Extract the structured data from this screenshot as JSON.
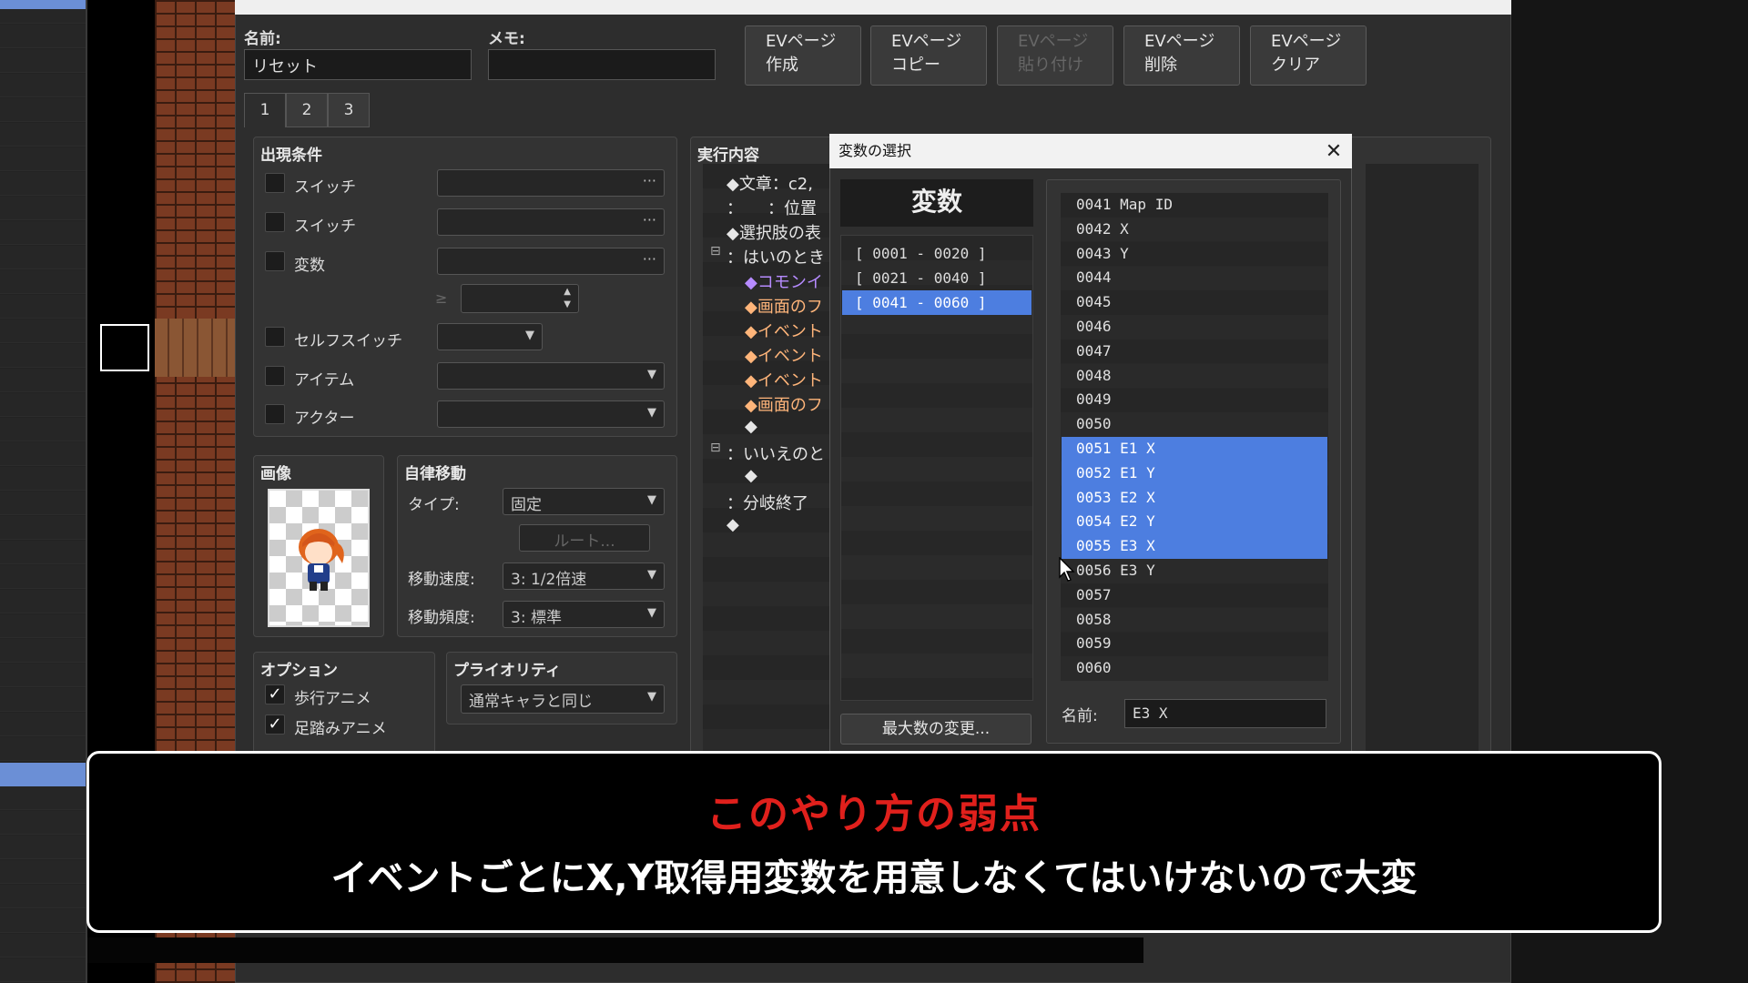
{
  "event_editor": {
    "name_label": "名前:",
    "name_value": "リセット",
    "memo_label": "メモ:",
    "memo_value": "",
    "buttons": [
      "EVページ\n作成",
      "EVページ\nコピー",
      "EVページ\n貼り付け",
      "EVページ\n削除",
      "EVページ\nクリア"
    ],
    "tabs": [
      "1",
      "2",
      "3"
    ],
    "conditions": {
      "title": "出現条件",
      "rows": [
        "スイッチ",
        "スイッチ",
        "変数",
        "セルフスイッチ",
        "アイテム",
        "アクター"
      ],
      "ge_symbol": "≥"
    },
    "image": {
      "title": "画像"
    },
    "autonomous": {
      "title": "自律移動",
      "type_label": "タイプ:",
      "type_value": "固定",
      "route_button": "ルート...",
      "speed_label": "移動速度:",
      "speed_value": "3: 1/2倍速",
      "freq_label": "移動頻度:",
      "freq_value": "3: 標準"
    },
    "options": {
      "title": "オプション",
      "items": [
        "歩行アニメ",
        "足踏みアニメ"
      ]
    },
    "priority": {
      "title": "プライオリティ",
      "value": "通常キャラと同じ"
    },
    "contents": {
      "title": "実行内容",
      "lines": [
        "◆文章：c2,",
        "：　　：位置",
        "◆選択肢の表",
        "：はいのとき",
        "◆コモンイ",
        "◆画面のフ",
        "◆イベント",
        "◆イベント",
        "◆イベント",
        "◆画面のフ",
        "◆",
        "：いいえのと",
        "◆",
        "：分岐終了",
        "◆"
      ]
    }
  },
  "variable_dialog": {
    "title": "変数の選択",
    "header": "変数",
    "groups": [
      "[ 0001 - 0020 ]",
      "[ 0021 - 0040 ]",
      "[ 0041 - 0060 ]"
    ],
    "selected_group": 2,
    "items": [
      "0041 Map ID",
      "0042 X",
      "0043 Y",
      "0044",
      "0045",
      "0046",
      "0047",
      "0048",
      "0049",
      "0050",
      "0051 E1 X",
      "0052 E1 Y",
      "0053 E2 X",
      "0054 E2 Y",
      "0055 E3 X",
      "0056 E3 Y",
      "0057",
      "0058",
      "0059",
      "0060"
    ],
    "selected_items": [
      10,
      11,
      12,
      13,
      14
    ],
    "max_button": "最大数の変更...",
    "name_label": "名前:",
    "name_value": "E3 X"
  },
  "subtitle": {
    "heading": "このやり方の弱点",
    "body": "イベントごとにX,Y取得用変数を用意しなくてはいけないので大変"
  },
  "colors": {
    "selection": "#4d7ee0",
    "subtitle_heading": "#e0201c"
  }
}
